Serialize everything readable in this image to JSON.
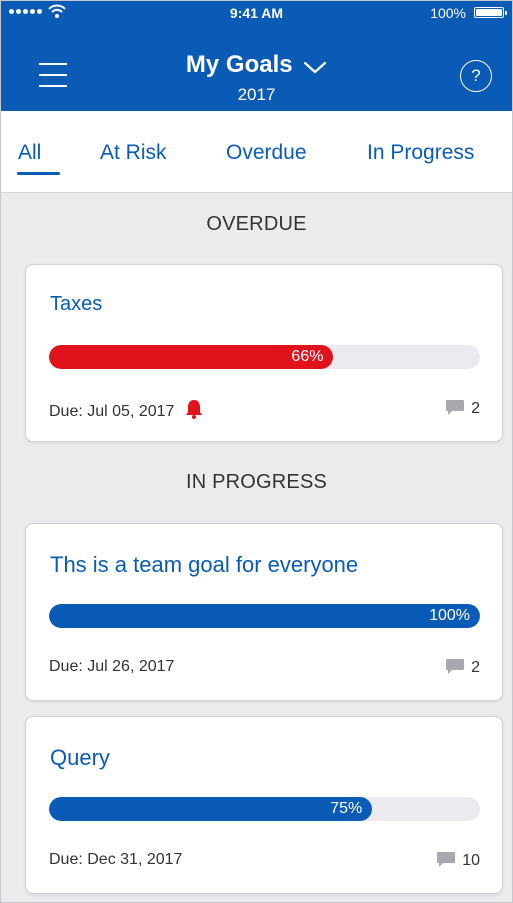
{
  "status_bar": {
    "time": "9:41 AM",
    "battery": "100%"
  },
  "header": {
    "title": "My Goals",
    "subtitle": "2017",
    "help": "?"
  },
  "tabs": [
    {
      "label": "All",
      "active": true
    },
    {
      "label": "At Risk",
      "active": false
    },
    {
      "label": "Overdue",
      "active": false
    },
    {
      "label": "In Progress",
      "active": false
    }
  ],
  "colors": {
    "brand": "#0a5bb5",
    "danger": "#e0121b",
    "background": "#ebebee"
  },
  "sections": [
    {
      "heading": "OVERDUE",
      "goals": [
        {
          "title": "Taxes",
          "progress": 66,
          "progress_label": "66%",
          "due": "Due: Jul 05, 2017",
          "alert_icon": "bell-icon",
          "comments": "2",
          "bar_color": "#e0121b"
        }
      ]
    },
    {
      "heading": "IN PROGRESS",
      "goals": [
        {
          "title": "Ths is a team goal for everyone",
          "progress": 100,
          "progress_label": "100%",
          "due": "Due: Jul 26, 2017",
          "comments": "2",
          "bar_color": "#0a5bb5"
        },
        {
          "title": "Query",
          "progress": 75,
          "progress_label": "75%",
          "due": "Due: Dec 31, 2017",
          "comments": "10",
          "bar_color": "#0a5bb5"
        }
      ]
    }
  ]
}
